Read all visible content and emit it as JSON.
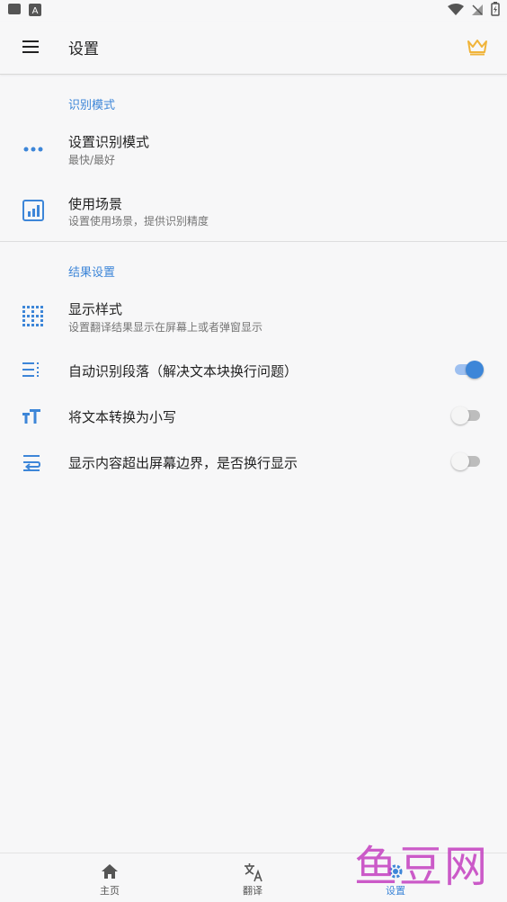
{
  "app_bar": {
    "title": "设置"
  },
  "sections": [
    {
      "header": "识别模式"
    },
    {
      "header": "结果设置"
    }
  ],
  "rows": [
    {
      "title": "设置识别模式",
      "subtitle": "最快/最好",
      "icon": "more-horiz-icon"
    },
    {
      "title": "使用场景",
      "subtitle": "设置使用场景，提供识别精度",
      "icon": "chart-box-icon"
    },
    {
      "title": "显示样式",
      "subtitle": "设置翻译结果显示在屏幕上或者弹窗显示",
      "icon": "dotted-grid-icon"
    },
    {
      "title": "自动识别段落（解决文本块换行问题）",
      "icon": "paragraph-icon",
      "toggle": true
    },
    {
      "title": "将文本转换为小写",
      "icon": "text-case-icon",
      "toggle": false
    },
    {
      "title": "显示内容超出屏幕边界，是否换行显示",
      "icon": "wrap-lines-icon",
      "toggle": false
    }
  ],
  "bottom_nav": [
    {
      "label": "主页",
      "icon": "home-icon"
    },
    {
      "label": "翻译",
      "icon": "translate-icon"
    },
    {
      "label": "设置",
      "icon": "settings-icon",
      "active": true
    }
  ],
  "watermark": "鱼豆网",
  "colors": {
    "accent": "#3d86d8",
    "crown": "#f0b43a",
    "watermark": "#c43fc0"
  }
}
